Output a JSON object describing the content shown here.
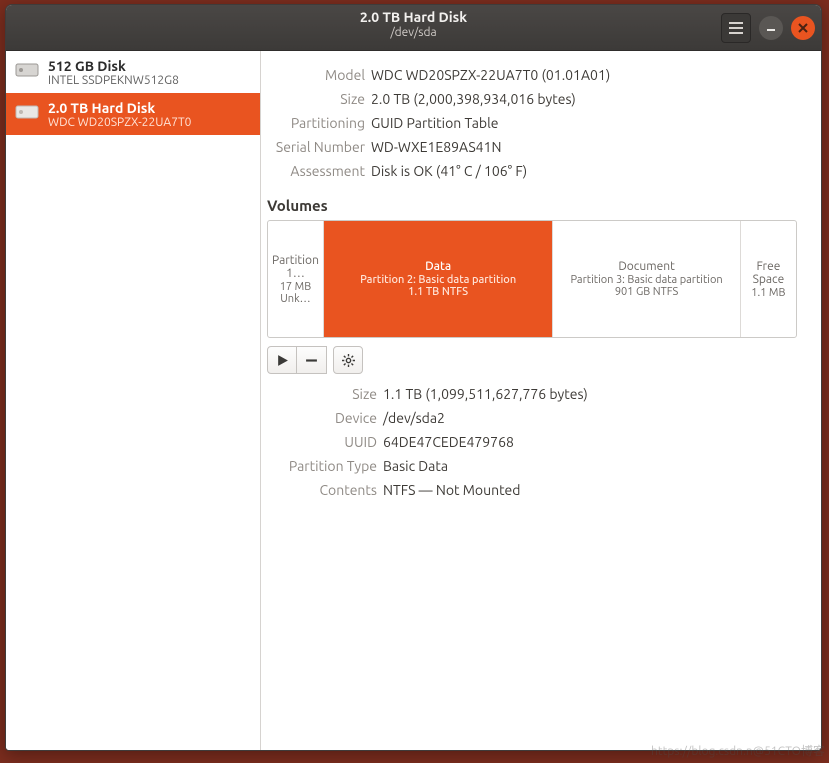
{
  "header": {
    "title": "2.0 TB Hard Disk",
    "subtitle": "/dev/sda"
  },
  "sidebar": {
    "items": [
      {
        "name": "512 GB Disk",
        "sub": "INTEL SSDPEKNW512G8",
        "selected": false
      },
      {
        "name": "2.0 TB Hard Disk",
        "sub": "WDC WD20SPZX-22UA7T0",
        "selected": true
      }
    ]
  },
  "disk": {
    "model_label": "Model",
    "model_value": "WDC WD20SPZX-22UA7T0 (01.01A01)",
    "size_label": "Size",
    "size_value": "2.0 TB (2,000,398,934,016 bytes)",
    "partitioning_label": "Partitioning",
    "partitioning_value": "GUID Partition Table",
    "serial_label": "Serial Number",
    "serial_value": "WD-WXE1E89AS41N",
    "assessment_label": "Assessment",
    "assessment_value": "Disk is OK (41° C / 106° F)"
  },
  "volumes_label": "Volumes",
  "volumes": [
    {
      "name": "Partition 1…",
      "sub1": "17 MB Unk…",
      "sub2": "",
      "flex": 7,
      "selected": false
    },
    {
      "name": "Data",
      "sub1": "Partition 2: Basic data partition",
      "sub2": "1.1 TB NTFS",
      "flex": 42,
      "selected": true
    },
    {
      "name": "Document",
      "sub1": "Partition 3: Basic data partition",
      "sub2": "901 GB NTFS",
      "flex": 34,
      "selected": false
    },
    {
      "name": "Free Space",
      "sub1": "1.1 MB",
      "sub2": "",
      "flex": 9,
      "selected": false
    }
  ],
  "partition": {
    "size_label": "Size",
    "size_value": "1.1 TB (1,099,511,627,776 bytes)",
    "device_label": "Device",
    "device_value": "/dev/sda2",
    "uuid_label": "UUID",
    "uuid_value": "64DE47CEDE479768",
    "ptype_label": "Partition Type",
    "ptype_value": "Basic Data",
    "contents_label": "Contents",
    "contents_value": "NTFS — Not Mounted"
  },
  "watermark": "https://blog.csdn.n@51CTO博客"
}
